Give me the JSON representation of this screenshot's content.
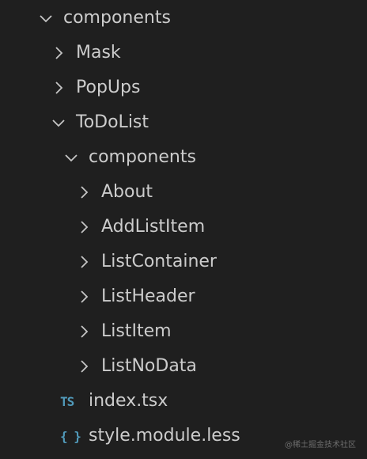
{
  "explorer": {
    "items": [
      {
        "label": "components",
        "expanded": true,
        "depth": 0
      },
      {
        "label": "Mask",
        "expanded": false,
        "depth": 1
      },
      {
        "label": "PopUps",
        "expanded": false,
        "depth": 1
      },
      {
        "label": "ToDoList",
        "expanded": true,
        "depth": 1
      },
      {
        "label": "components",
        "expanded": true,
        "depth": 2
      },
      {
        "label": "About",
        "expanded": false,
        "depth": 3
      },
      {
        "label": "AddListItem",
        "expanded": false,
        "depth": 3
      },
      {
        "label": "ListContainer",
        "expanded": false,
        "depth": 3
      },
      {
        "label": "ListHeader",
        "expanded": false,
        "depth": 3
      },
      {
        "label": "ListItem",
        "expanded": false,
        "depth": 3
      },
      {
        "label": "ListNoData",
        "expanded": false,
        "depth": 3
      }
    ],
    "files": [
      {
        "label": "index.tsx",
        "icon": "typescript-icon",
        "glyph": "TS",
        "color": "#519aba"
      },
      {
        "label": "style.module.less",
        "icon": "braces-icon",
        "glyph": "{ }",
        "color": "#519aba"
      }
    ]
  },
  "watermark": "@稀土掘金技术社区",
  "colors": {
    "background": "#1f1f1f",
    "text": "#cccccc",
    "chevron": "#c5c5c5",
    "icon_blue": "#519aba"
  }
}
